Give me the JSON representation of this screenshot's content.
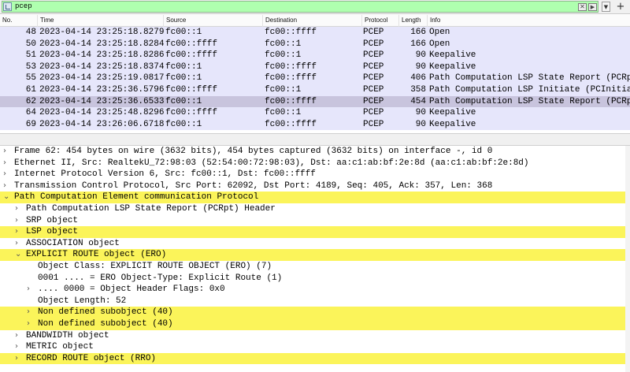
{
  "filter": {
    "value": "pcep",
    "clear_icon": "clear-x-icon",
    "apply_icon": "apply-arrow-icon",
    "dropdown_icon": "chevron-down-icon",
    "add_label": "+"
  },
  "packet_list": {
    "columns": [
      "No.",
      "Time",
      "Source",
      "Destination",
      "Protocol",
      "Length",
      "Info"
    ],
    "rows": [
      {
        "no": "48",
        "time": "2023-04-14 23:25:18.827908",
        "src": "fc00::1",
        "dst": "fc00::ffff",
        "proto": "PCEP",
        "len": "166",
        "info": "Open"
      },
      {
        "no": "50",
        "time": "2023-04-14 23:25:18.828485",
        "src": "fc00::ffff",
        "dst": "fc00::1",
        "proto": "PCEP",
        "len": "166",
        "info": "Open"
      },
      {
        "no": "51",
        "time": "2023-04-14 23:25:18.828603",
        "src": "fc00::ffff",
        "dst": "fc00::1",
        "proto": "PCEP",
        "len": "90",
        "info": "Keepalive"
      },
      {
        "no": "53",
        "time": "2023-04-14 23:25:18.837442",
        "src": "fc00::1",
        "dst": "fc00::ffff",
        "proto": "PCEP",
        "len": "90",
        "info": "Keepalive"
      },
      {
        "no": "55",
        "time": "2023-04-14 23:25:19.081765",
        "src": "fc00::1",
        "dst": "fc00::ffff",
        "proto": "PCEP",
        "len": "406",
        "info": "Path Computation LSP State Report (PCRpt)"
      },
      {
        "no": "61",
        "time": "2023-04-14 23:25:36.579692",
        "src": "fc00::ffff",
        "dst": "fc00::1",
        "proto": "PCEP",
        "len": "358",
        "info": "Path Computation LSP Initiate (PCInitiate)"
      },
      {
        "no": "62",
        "time": "2023-04-14 23:25:36.653386",
        "src": "fc00::1",
        "dst": "fc00::ffff",
        "proto": "PCEP",
        "len": "454",
        "info": "Path Computation LSP State Report (PCRpt)",
        "selected": true
      },
      {
        "no": "64",
        "time": "2023-04-14 23:25:48.829686",
        "src": "fc00::ffff",
        "dst": "fc00::1",
        "proto": "PCEP",
        "len": "90",
        "info": "Keepalive"
      },
      {
        "no": "69",
        "time": "2023-04-14 23:26:06.671808",
        "src": "fc00::1",
        "dst": "fc00::ffff",
        "proto": "PCEP",
        "len": "90",
        "info": "Keepalive"
      }
    ],
    "row_bg": "#e6e6fb",
    "selected_bg": "#c8c4dd"
  },
  "details": {
    "highlight_color": "#fbf45a",
    "items": [
      {
        "text": "Frame 62: 454 bytes on wire (3632 bits), 454 bytes captured (3632 bits) on interface -, id 0",
        "level": 0,
        "toggle": "closed",
        "hl": false
      },
      {
        "text": "Ethernet II, Src: RealtekU_72:98:03 (52:54:00:72:98:03), Dst: aa:c1:ab:bf:2e:8d (aa:c1:ab:bf:2e:8d)",
        "level": 0,
        "toggle": "closed",
        "hl": false
      },
      {
        "text": "Internet Protocol Version 6, Src: fc00::1, Dst: fc00::ffff",
        "level": 0,
        "toggle": "closed",
        "hl": false
      },
      {
        "text": "Transmission Control Protocol, Src Port: 62092, Dst Port: 4189, Seq: 405, Ack: 357, Len: 368",
        "level": 0,
        "toggle": "closed",
        "hl": false
      },
      {
        "text": "Path Computation Element communication Protocol",
        "level": 0,
        "toggle": "open",
        "hl": true
      },
      {
        "text": "Path Computation LSP State Report (PCRpt) Header",
        "level": 1,
        "toggle": "closed",
        "hl": false
      },
      {
        "text": "SRP object",
        "level": 1,
        "toggle": "closed",
        "hl": false
      },
      {
        "text": "LSP object",
        "level": 1,
        "toggle": "closed",
        "hl": true
      },
      {
        "text": "ASSOCIATION object",
        "level": 1,
        "toggle": "closed",
        "hl": false
      },
      {
        "text": "EXPLICIT ROUTE object (ERO)",
        "level": 1,
        "toggle": "open",
        "hl": true
      },
      {
        "text": "Object Class: EXPLICIT ROUTE OBJECT (ERO) (7)",
        "level": 2,
        "toggle": "none",
        "hl": false
      },
      {
        "text": "0001 .... = ERO Object-Type: Explicit Route (1)",
        "level": 2,
        "toggle": "none",
        "hl": false
      },
      {
        "text": ".... 0000 = Object Header Flags: 0x0",
        "level": 2,
        "toggle": "closed",
        "hl": false
      },
      {
        "text": "Object Length: 52",
        "level": 2,
        "toggle": "none",
        "hl": false
      },
      {
        "text": "Non defined subobject (40)",
        "level": 2,
        "toggle": "closed",
        "hl": true
      },
      {
        "text": "Non defined subobject (40)",
        "level": 2,
        "toggle": "closed",
        "hl": true
      },
      {
        "text": "BANDWIDTH object",
        "level": 1,
        "toggle": "closed",
        "hl": false
      },
      {
        "text": "METRIC object",
        "level": 1,
        "toggle": "closed",
        "hl": false
      },
      {
        "text": "RECORD ROUTE object (RRO)",
        "level": 1,
        "toggle": "closed",
        "hl": true
      }
    ]
  }
}
